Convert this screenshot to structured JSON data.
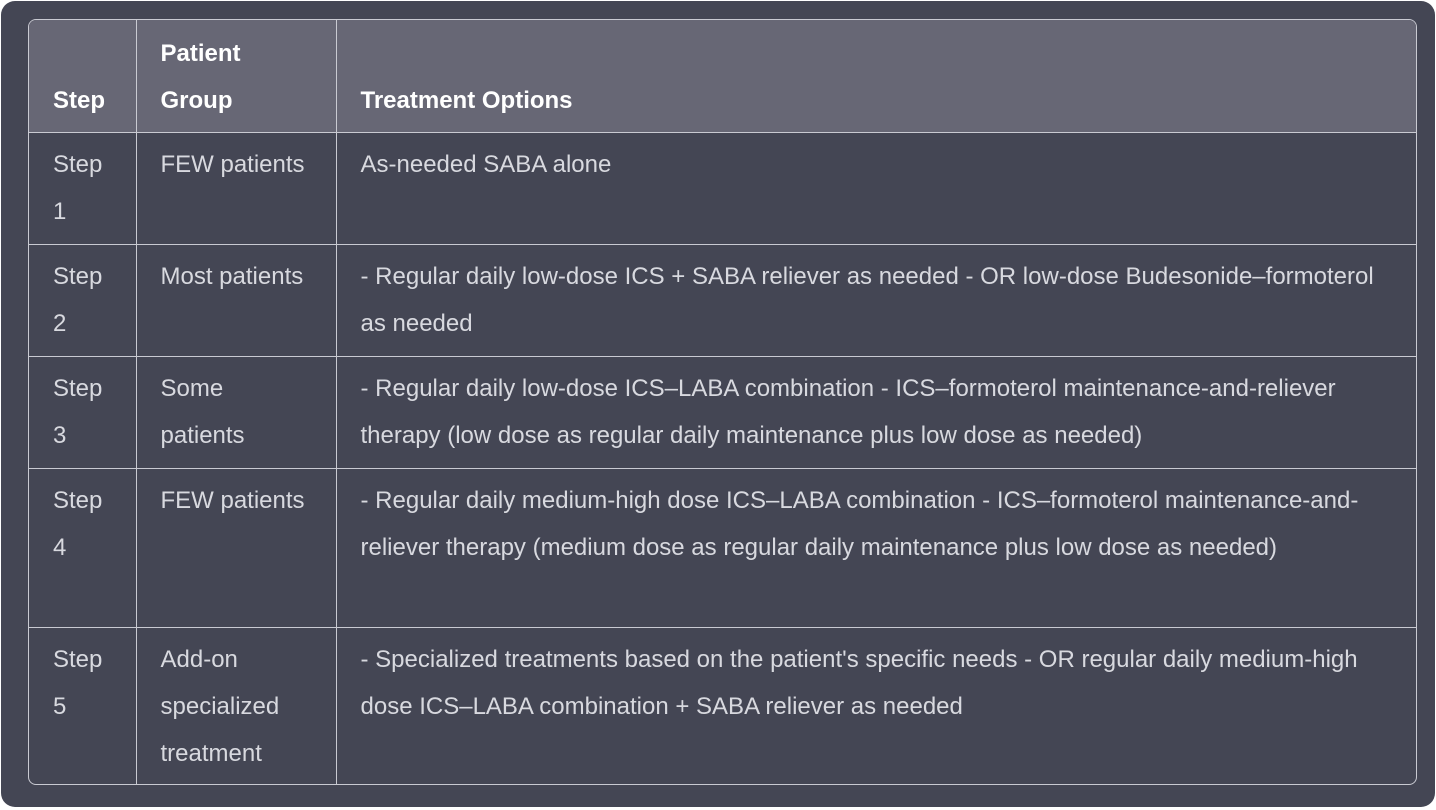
{
  "table": {
    "headers": [
      "Step",
      "Patient Group",
      "Treatment Options"
    ],
    "rows": [
      {
        "step": "Step 1",
        "group": "FEW patients",
        "treatment": "As-needed SABA alone"
      },
      {
        "step": "Step 2",
        "group": "Most patients",
        "treatment": "- Regular daily low-dose ICS + SABA reliever as needed - OR low-dose Budesonide–formoterol as needed"
      },
      {
        "step": "Step 3",
        "group": "Some patients",
        "treatment": "- Regular daily low-dose ICS–LABA combination - ICS–formoterol maintenance-and-reliever therapy (low dose as regular daily maintenance plus low dose as needed)"
      },
      {
        "step": "Step 4",
        "group": "FEW patients",
        "treatment": "- Regular daily medium-high dose ICS–LABA combination - ICS–formoterol maintenance-and-reliever therapy (medium dose as regular daily maintenance plus low dose as needed)"
      },
      {
        "step": "Step 5",
        "group": "Add-on specialized treatment",
        "treatment": "- Specialized treatments based on the patient's specific needs - OR regular daily medium-high dose ICS–LABA combination + SABA reliever as needed"
      }
    ]
  }
}
